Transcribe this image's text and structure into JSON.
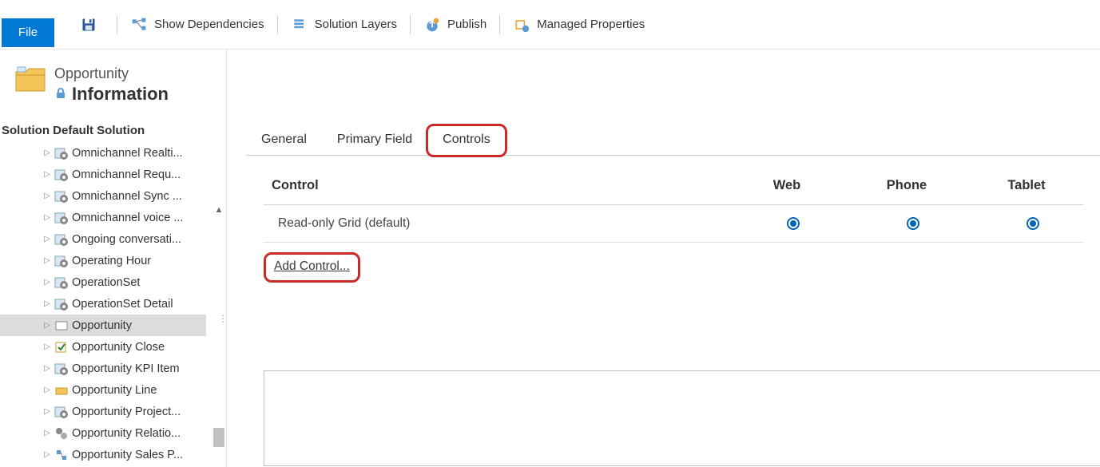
{
  "ribbon": {
    "file": "File",
    "items": [
      {
        "label": "",
        "icon": "save"
      },
      {
        "label": "Show Dependencies",
        "icon": "deps"
      },
      {
        "label": "Solution Layers",
        "icon": "layers"
      },
      {
        "label": "Publish",
        "icon": "publish"
      },
      {
        "label": "Managed Properties",
        "icon": "managed"
      }
    ]
  },
  "header": {
    "entity": "Opportunity",
    "title": "Information"
  },
  "solution": {
    "label": "Solution",
    "name": "Default Solution"
  },
  "tree": [
    {
      "label": "Omnichannel Realti...",
      "icon": "gear",
      "selected": false
    },
    {
      "label": "Omnichannel Requ...",
      "icon": "gear",
      "selected": false
    },
    {
      "label": "Omnichannel Sync ...",
      "icon": "gear",
      "selected": false
    },
    {
      "label": "Omnichannel voice ...",
      "icon": "gear",
      "selected": false
    },
    {
      "label": "Ongoing conversati...",
      "icon": "gear",
      "selected": false
    },
    {
      "label": "Operating Hour",
      "icon": "gear",
      "selected": false
    },
    {
      "label": "OperationSet",
      "icon": "gear",
      "selected": false
    },
    {
      "label": "OperationSet Detail",
      "icon": "gear",
      "selected": false
    },
    {
      "label": "Opportunity",
      "icon": "entity",
      "selected": true
    },
    {
      "label": "Opportunity Close",
      "icon": "close",
      "selected": false
    },
    {
      "label": "Opportunity KPI Item",
      "icon": "gear",
      "selected": false
    },
    {
      "label": "Opportunity Line",
      "icon": "line",
      "selected": false
    },
    {
      "label": "Opportunity Project...",
      "icon": "gear",
      "selected": false
    },
    {
      "label": "Opportunity Relatio...",
      "icon": "rel",
      "selected": false
    },
    {
      "label": "Opportunity Sales P...",
      "icon": "sales",
      "selected": false
    }
  ],
  "tabs": [
    {
      "label": "General",
      "active": false,
      "highlight": false
    },
    {
      "label": "Primary Field",
      "active": false,
      "highlight": false
    },
    {
      "label": "Controls",
      "active": true,
      "highlight": true
    }
  ],
  "controls_table": {
    "headers": {
      "control": "Control",
      "web": "Web",
      "phone": "Phone",
      "tablet": "Tablet"
    },
    "rows": [
      {
        "name": "Read-only Grid (default)",
        "web": true,
        "phone": true,
        "tablet": true
      }
    ],
    "add_link": "Add Control..."
  }
}
